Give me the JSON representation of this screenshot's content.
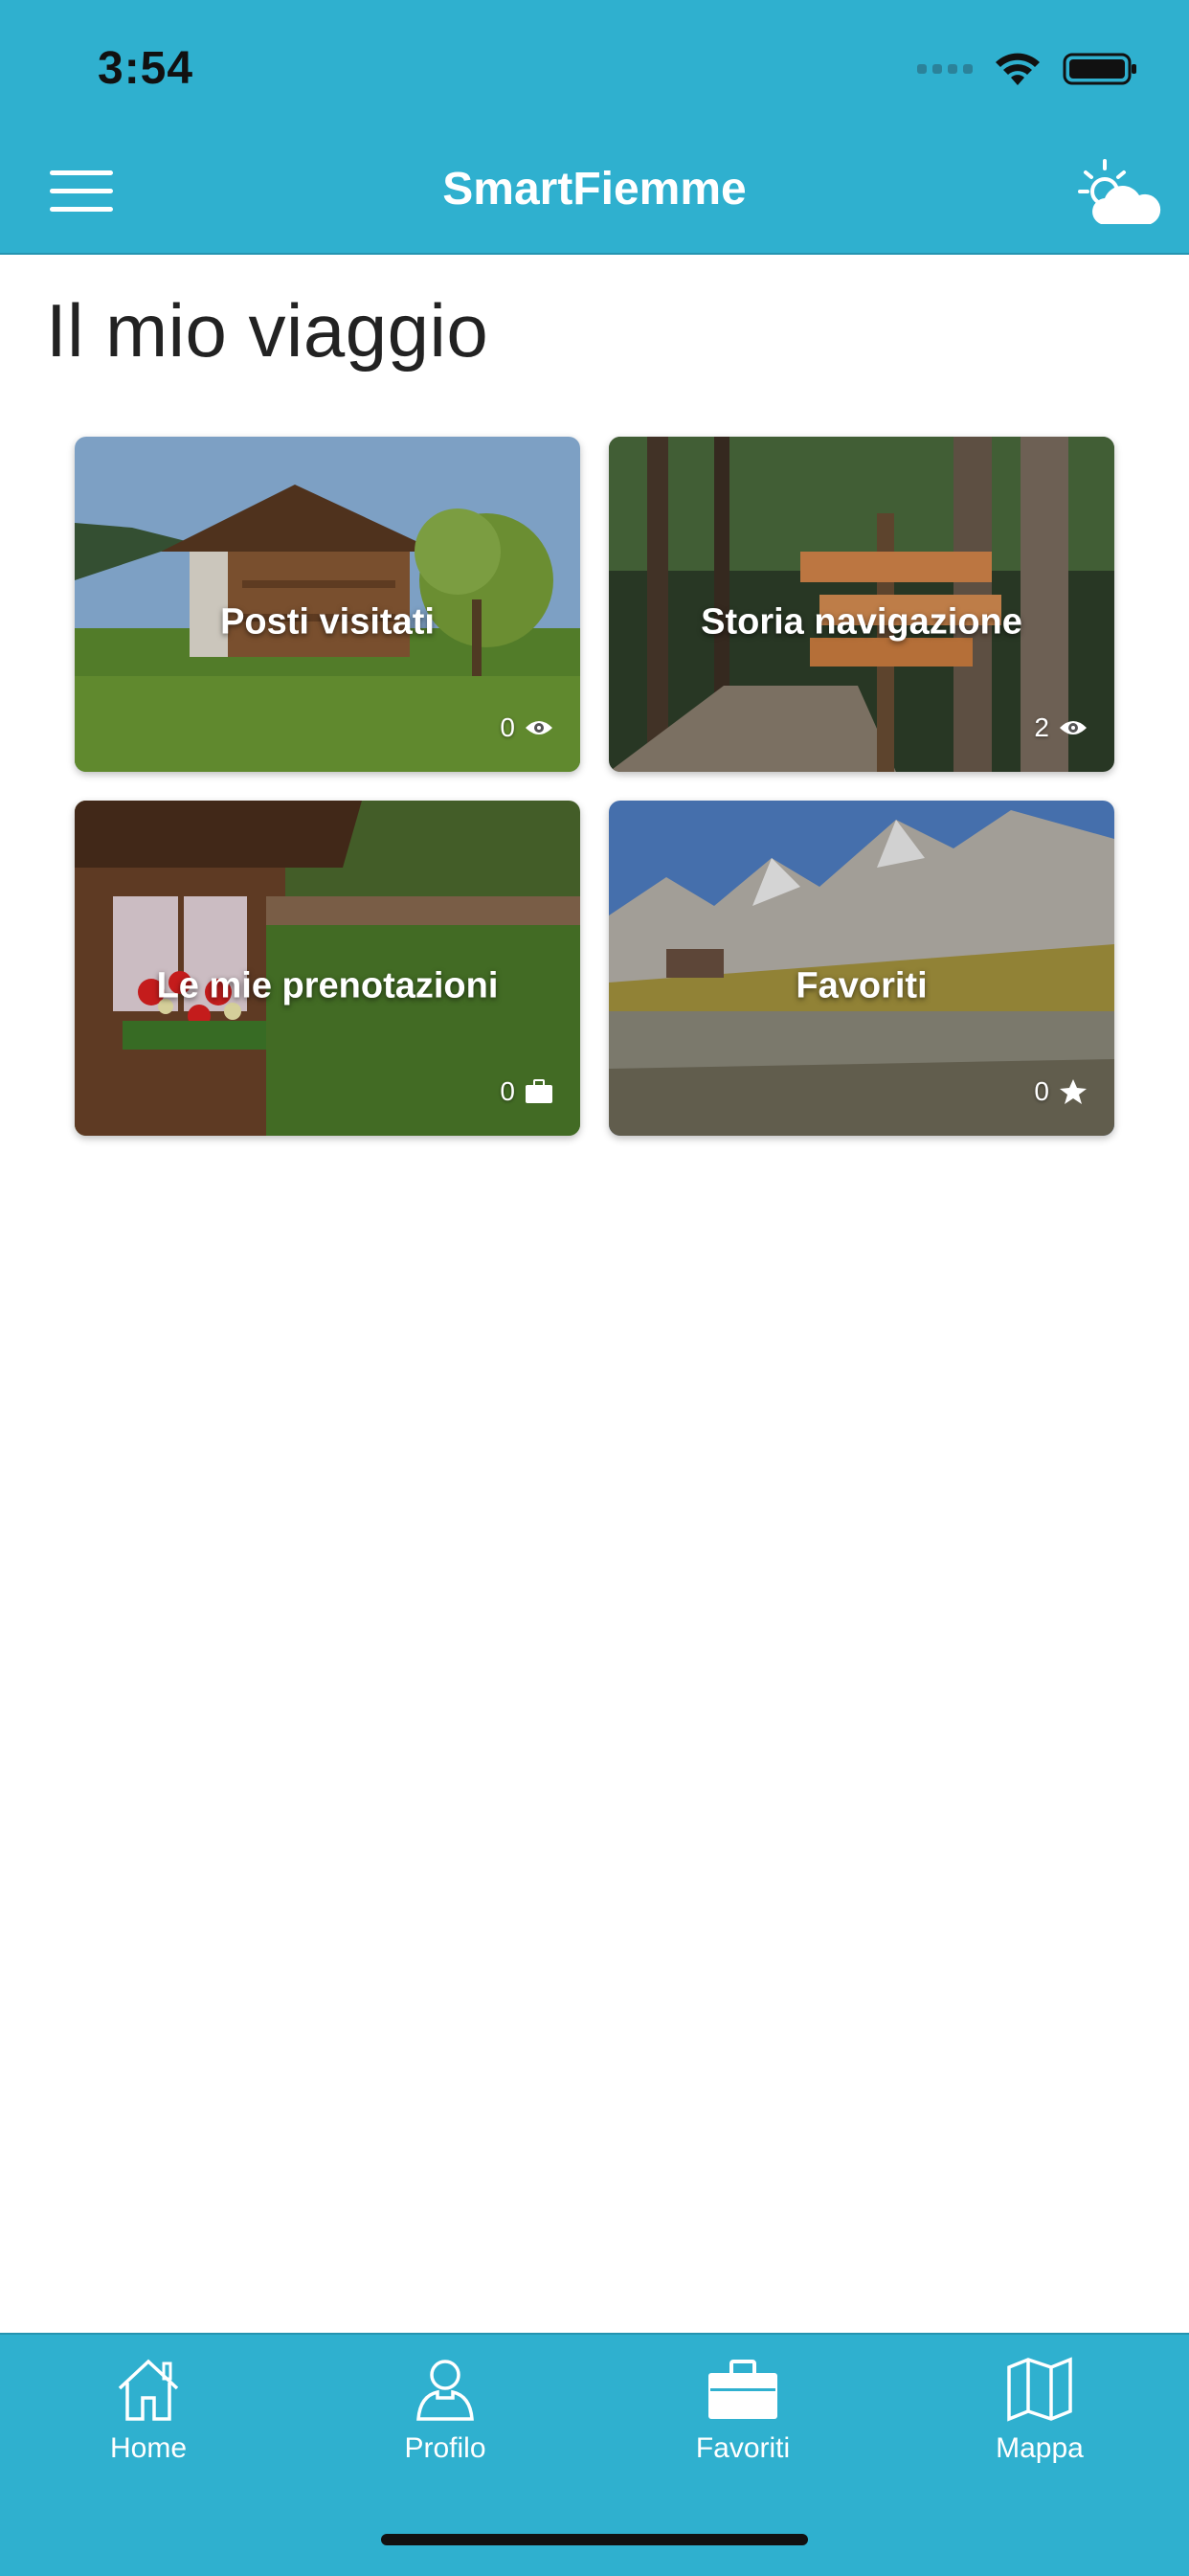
{
  "status_bar": {
    "time": "3:54"
  },
  "header": {
    "title": "SmartFiemme",
    "menu_icon": "hamburger-menu-icon",
    "weather_icon": "partly-cloudy-icon"
  },
  "page": {
    "title": "Il mio viaggio"
  },
  "cards": [
    {
      "label": "Posti visitati",
      "count": "0",
      "icon": "eye-icon"
    },
    {
      "label": "Storia navigazione",
      "count": "2",
      "icon": "eye-icon"
    },
    {
      "label": "Le mie prenotazioni",
      "count": "0",
      "icon": "briefcase-icon"
    },
    {
      "label": "Favoriti",
      "count": "0",
      "icon": "star-icon"
    }
  ],
  "tabbar": {
    "items": [
      {
        "label": "Home",
        "icon": "home-icon"
      },
      {
        "label": "Profilo",
        "icon": "user-icon"
      },
      {
        "label": "Favoriti",
        "icon": "briefcase-icon"
      },
      {
        "label": "Mappa",
        "icon": "map-icon"
      }
    ]
  },
  "colors": {
    "brand": "#2fb0cf",
    "text": "#222222",
    "background": "#ffffff"
  }
}
